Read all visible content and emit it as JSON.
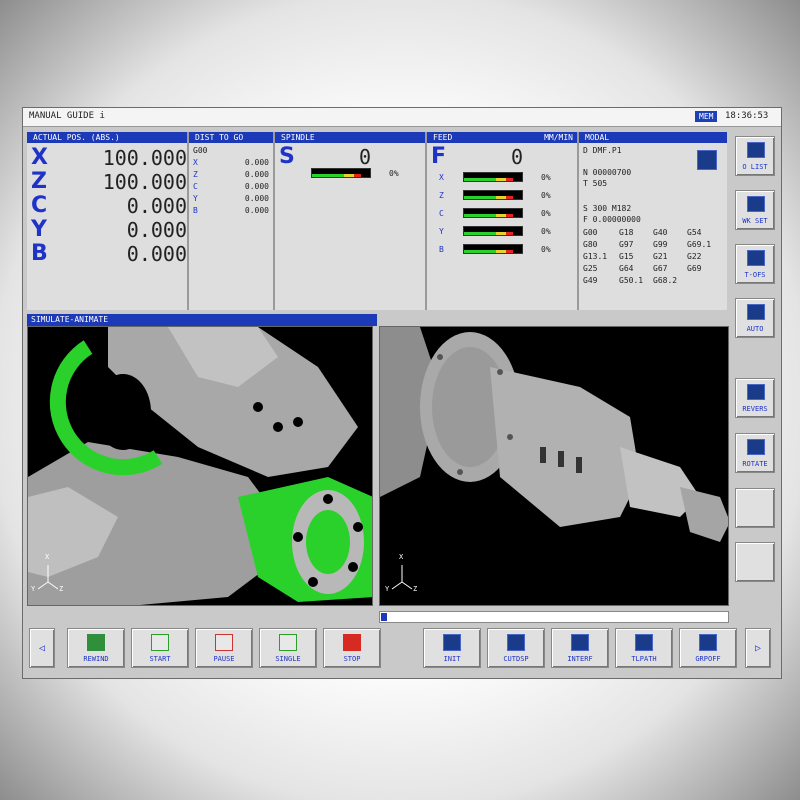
{
  "title": "MANUAL GUIDE i",
  "mem_badge": "MEM",
  "clock": "18:36:53",
  "actual_pos": {
    "header": "ACTUAL POS. (ABS.)",
    "axes": [
      {
        "label": "X",
        "value": "100.000"
      },
      {
        "label": "Z",
        "value": "100.000"
      },
      {
        "label": "C",
        "value": "0.000"
      },
      {
        "label": "Y",
        "value": "0.000"
      },
      {
        "label": "B",
        "value": "0.000"
      }
    ]
  },
  "dist_to_go": {
    "header": "DIST TO GO",
    "code": "G00",
    "axes": [
      {
        "label": "X",
        "value": "0.000"
      },
      {
        "label": "Z",
        "value": "0.000"
      },
      {
        "label": "C",
        "value": "0.000"
      },
      {
        "label": "Y",
        "value": "0.000"
      },
      {
        "label": "B",
        "value": "0.000"
      }
    ]
  },
  "spindle": {
    "header": "SPINDLE",
    "letter": "S",
    "value": "0",
    "load_pct": "0%",
    "load_fraction": 0.55
  },
  "feed": {
    "header": "FEED",
    "unit": "MM/MIN",
    "letter": "F",
    "value": "0",
    "axes": [
      {
        "label": "X",
        "pct": "0%",
        "load_fraction": 0.55
      },
      {
        "label": "Z",
        "pct": "0%",
        "load_fraction": 0.55
      },
      {
        "label": "C",
        "pct": "0%",
        "load_fraction": 0.55
      },
      {
        "label": "Y",
        "pct": "0%",
        "load_fraction": 0.55
      },
      {
        "label": "B",
        "pct": "0%",
        "load_fraction": 0.55
      }
    ]
  },
  "modal": {
    "header": "MODAL",
    "d_line": "D DMF.P1",
    "n_line": "N 00000700",
    "t_line": "T 505",
    "s_line": "S    300 M182",
    "f_line": "F 0.00000000",
    "gcodes": [
      [
        "G00",
        "G18",
        "G40",
        "G54"
      ],
      [
        "G80",
        "G97",
        "G99",
        "G69.1"
      ],
      [
        "G13.1",
        "G15",
        "G21",
        "G22"
      ],
      [
        "G25",
        "G64",
        "G67",
        "G69"
      ],
      [
        "G49",
        "G50.1",
        "G68.2",
        ""
      ]
    ]
  },
  "simulate": {
    "header": "SIMULATE-ANIMATE"
  },
  "axis_triad": {
    "x": "X",
    "y": "Y",
    "z": "Z"
  },
  "right_softkeys": [
    {
      "label": "O LIST",
      "icon": "program-list-icon"
    },
    {
      "label": "WK SET",
      "icon": "work-set-icon"
    },
    {
      "label": "T-OFS",
      "icon": "tool-offset-icon"
    },
    {
      "label": "AUTO",
      "icon": "auto-icon"
    },
    {
      "label": "REVERS",
      "icon": "reverse-icon"
    },
    {
      "label": "ROTATE",
      "icon": "rotate-icon"
    },
    {
      "label": "",
      "icon": ""
    },
    {
      "label": "",
      "icon": ""
    }
  ],
  "bottom_softkeys": [
    {
      "label": "REWIND",
      "icon": "rewind-icon"
    },
    {
      "label": "START",
      "icon": "play-icon"
    },
    {
      "label": "PAUSE",
      "icon": "pause-icon"
    },
    {
      "label": "SINGLE",
      "icon": "single-step-icon"
    },
    {
      "label": "STOP",
      "icon": "stop-icon"
    },
    {
      "label": "INIT",
      "icon": "init-icon"
    },
    {
      "label": "CUTDSP",
      "icon": "cut-display-icon"
    },
    {
      "label": "INTERF",
      "icon": "interference-icon"
    },
    {
      "label": "TLPATH",
      "icon": "tool-path-icon"
    },
    {
      "label": "GRPOFF",
      "icon": "graphics-off-icon"
    }
  ],
  "nav": {
    "left": "◁",
    "right": "▷"
  },
  "colors": {
    "header_blue": "#1c3ab8",
    "label_blue": "#1f33c8",
    "panel_bg": "#dedede",
    "green_surface": "#2ad12a"
  }
}
